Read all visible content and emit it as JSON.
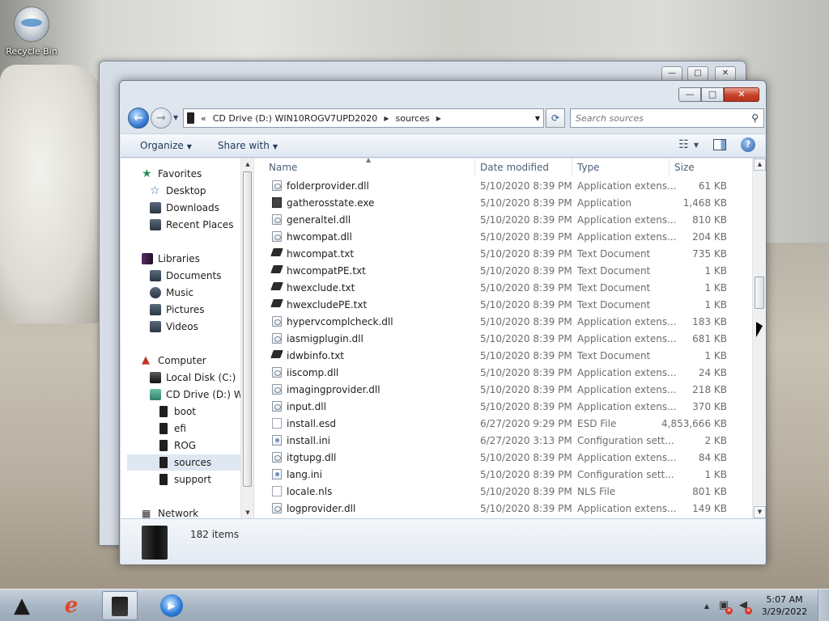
{
  "desktop": {
    "recycle_bin_label": "Recycle Bin"
  },
  "window": {
    "back_button": "←",
    "forward_button": "→",
    "address": {
      "prefix": "«",
      "segments": [
        "CD Drive (D:) WIN10ROGV7UPD2020",
        "sources"
      ]
    },
    "search_placeholder": "Search sources",
    "caption": {
      "minimize": "—",
      "maximize": "□",
      "close": "✕"
    }
  },
  "toolbar": {
    "organize_label": "Organize",
    "share_label": "Share with"
  },
  "nav_pane": {
    "favorites": "Favorites",
    "favorite_items": [
      "Desktop",
      "Downloads",
      "Recent Places"
    ],
    "libraries": "Libraries",
    "library_items": [
      "Documents",
      "Music",
      "Pictures",
      "Videos"
    ],
    "computer": "Computer",
    "drives": [
      "Local Disk (C:)",
      "CD Drive (D:) WIN"
    ],
    "folders": [
      "boot",
      "efi",
      "ROG",
      "sources",
      "support"
    ],
    "selected_folder": "sources",
    "network": "Network"
  },
  "columns": {
    "name": "Name",
    "date": "Date modified",
    "type": "Type",
    "size": "Size"
  },
  "files": [
    {
      "name": "folderprovider.dll",
      "date": "5/10/2020 8:39 PM",
      "type": "Application extens...",
      "size": "61 KB",
      "icon": "dll-icon"
    },
    {
      "name": "gatherosstate.exe",
      "date": "5/10/2020 8:39 PM",
      "type": "Application",
      "size": "1,468 KB",
      "icon": "exe-icon"
    },
    {
      "name": "generaltel.dll",
      "date": "5/10/2020 8:39 PM",
      "type": "Application extens...",
      "size": "810 KB",
      "icon": "dll-icon"
    },
    {
      "name": "hwcompat.dll",
      "date": "5/10/2020 8:39 PM",
      "type": "Application extens...",
      "size": "204 KB",
      "icon": "dll-icon"
    },
    {
      "name": "hwcompat.txt",
      "date": "5/10/2020 8:39 PM",
      "type": "Text Document",
      "size": "735 KB",
      "icon": "txt-icon"
    },
    {
      "name": "hwcompatPE.txt",
      "date": "5/10/2020 8:39 PM",
      "type": "Text Document",
      "size": "1 KB",
      "icon": "txt-icon"
    },
    {
      "name": "hwexclude.txt",
      "date": "5/10/2020 8:39 PM",
      "type": "Text Document",
      "size": "1 KB",
      "icon": "txt-icon"
    },
    {
      "name": "hwexcludePE.txt",
      "date": "5/10/2020 8:39 PM",
      "type": "Text Document",
      "size": "1 KB",
      "icon": "txt-icon"
    },
    {
      "name": "hypervcomplcheck.dll",
      "date": "5/10/2020 8:39 PM",
      "type": "Application extens...",
      "size": "183 KB",
      "icon": "dll-icon"
    },
    {
      "name": "iasmigplugin.dll",
      "date": "5/10/2020 8:39 PM",
      "type": "Application extens...",
      "size": "681 KB",
      "icon": "dll-icon"
    },
    {
      "name": "idwbinfo.txt",
      "date": "5/10/2020 8:39 PM",
      "type": "Text Document",
      "size": "1 KB",
      "icon": "txt-icon"
    },
    {
      "name": "iiscomp.dll",
      "date": "5/10/2020 8:39 PM",
      "type": "Application extens...",
      "size": "24 KB",
      "icon": "dll-icon"
    },
    {
      "name": "imagingprovider.dll",
      "date": "5/10/2020 8:39 PM",
      "type": "Application extens...",
      "size": "218 KB",
      "icon": "dll-icon"
    },
    {
      "name": "input.dll",
      "date": "5/10/2020 8:39 PM",
      "type": "Application extens...",
      "size": "370 KB",
      "icon": "dll-icon"
    },
    {
      "name": "install.esd",
      "date": "6/27/2020 9:29 PM",
      "type": "ESD File",
      "size": "4,853,666 KB",
      "icon": "file-icon"
    },
    {
      "name": "install.ini",
      "date": "6/27/2020 3:13 PM",
      "type": "Configuration sett...",
      "size": "2 KB",
      "icon": "ini-icon"
    },
    {
      "name": "itgtupg.dll",
      "date": "5/10/2020 8:39 PM",
      "type": "Application extens...",
      "size": "84 KB",
      "icon": "dll-icon"
    },
    {
      "name": "lang.ini",
      "date": "5/10/2020 8:39 PM",
      "type": "Configuration sett...",
      "size": "1 KB",
      "icon": "ini-icon"
    },
    {
      "name": "locale.nls",
      "date": "5/10/2020 8:39 PM",
      "type": "NLS File",
      "size": "801 KB",
      "icon": "file-icon"
    },
    {
      "name": "logprovider.dll",
      "date": "5/10/2020 8:39 PM",
      "type": "Application extens...",
      "size": "149 KB",
      "icon": "dll-icon"
    }
  ],
  "status": {
    "item_count": "182 items"
  },
  "taskbar": {
    "time": "5:07 AM",
    "date": "3/29/2022"
  }
}
